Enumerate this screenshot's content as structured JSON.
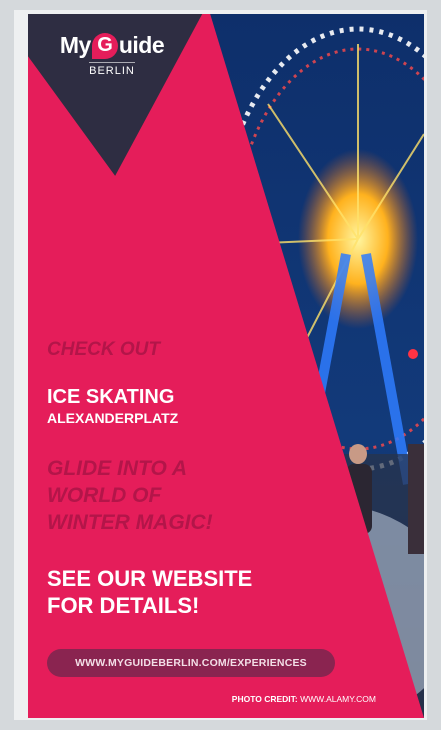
{
  "logo": {
    "text_before": "My",
    "text_g": "G",
    "text_after": "uide",
    "city": "BERLIN"
  },
  "headline": {
    "kicker": "CHECK OUT",
    "event": "ICE SKATING",
    "location": "ALEXANDERPLATZ"
  },
  "tagline": "GLIDE INTO A\nWORLD OF\nWINTER MAGIC!",
  "cta": "SEE OUR WEBSITE\nFOR DETAILS!",
  "url": "WWW.MYGUIDEBERLIN.COM/EXPERIENCES",
  "credit": {
    "label": "PHOTO CREDIT:",
    "site": "WWW.ALAMY.COM"
  },
  "colors": {
    "brand_pink": "#e51d5a",
    "dark_navy": "#2e2d42",
    "accent_text": "#b31549",
    "pill": "#8a2450"
  }
}
